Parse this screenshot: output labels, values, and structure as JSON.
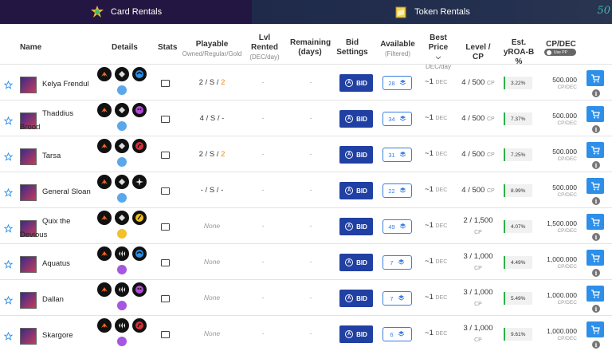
{
  "tabs": [
    {
      "label": "Card Rentals",
      "icon": "card-rentals-icon"
    },
    {
      "label": "Token Rentals",
      "icon": "token-rentals-icon"
    }
  ],
  "corner_badge": "50",
  "columns": {
    "name": "Name",
    "details": "Details",
    "stats": "Stats",
    "playable": "Playable",
    "playable_sub": "Owned/Regular/Gold",
    "lvl_rented": "Lvl Rented",
    "lvl_rented_sub": "(DEC/day)",
    "remaining": "Remaining (days)",
    "bid_settings": "Bid Settings",
    "available": "Available",
    "available_sub": "(Filtered)",
    "best_price": "Best Price",
    "best_price_sub": "DEC/day",
    "level_cp": "Level / CP",
    "yroa": "Est. yROA-B %",
    "cp_dec": "CP/DEC",
    "use_pp": "Use PP"
  },
  "colors": {
    "bid": "#2140a3",
    "cart": "#2d8fe8",
    "yroa_bar": "#2db04a",
    "gold": "#e58a1f"
  },
  "labels": {
    "bid": "BID",
    "dec": "DEC",
    "cp": "CP",
    "cp_dec": "CP/DEC",
    "dash": "-",
    "none": "None",
    "approx_prefix": "~"
  },
  "rows": [
    {
      "name": "Kelya Frendul",
      "wrap": false,
      "play_owned": "2",
      "play_regular": "S",
      "play_gold": "2",
      "play_none": false,
      "available": "28",
      "price": "1",
      "level": "4 / 500",
      "level_two_line": false,
      "yroa": "3.22%",
      "cp_dec": "500.000",
      "elements": [
        "fire",
        "neutral",
        "water",
        "water-gem"
      ]
    },
    {
      "name": "Thaddius Brood",
      "wrap": true,
      "play_owned": "4",
      "play_regular": "S",
      "play_gold": "-",
      "play_none": false,
      "available": "34",
      "price": "1",
      "level": "4 / 500",
      "level_two_line": false,
      "yroa": "7.37%",
      "cp_dec": "500.000",
      "elements": [
        "fire",
        "neutral",
        "death",
        "water-gem"
      ]
    },
    {
      "name": "Tarsa",
      "wrap": false,
      "play_owned": "2",
      "play_regular": "S",
      "play_gold": "2",
      "play_none": false,
      "available": "31",
      "price": "1",
      "level": "4 / 500",
      "level_two_line": false,
      "yroa": "7.25%",
      "cp_dec": "500.000",
      "elements": [
        "fire",
        "neutral",
        "fire-dragon",
        "water-gem"
      ]
    },
    {
      "name": "General Sloan",
      "wrap": false,
      "play_owned": "-",
      "play_regular": "S",
      "play_gold": "-",
      "play_none": false,
      "available": "22",
      "price": "1",
      "level": "4 / 500",
      "level_two_line": false,
      "yroa": "8.99%",
      "cp_dec": "500.000",
      "elements": [
        "fire",
        "neutral",
        "life",
        "water-gem"
      ]
    },
    {
      "name": "Quix the Devious",
      "wrap": true,
      "play_owned": "",
      "play_regular": "",
      "play_gold": "",
      "play_none": true,
      "available": "49",
      "price": "1",
      "level": "2 / 1,500",
      "level_two_line": true,
      "yroa": "4.07%",
      "cp_dec": "1,500.000",
      "elements": [
        "fire",
        "neutral",
        "earth",
        "gold-gem"
      ]
    },
    {
      "name": "Aquatus",
      "wrap": false,
      "play_owned": "",
      "play_regular": "",
      "play_gold": "",
      "play_none": true,
      "available": "7",
      "price": "1",
      "level": "3 / 1,000",
      "level_two_line": true,
      "yroa": "4.49%",
      "cp_dec": "1,000.000",
      "elements": [
        "fire",
        "wave",
        "water",
        "purple-gem"
      ]
    },
    {
      "name": "Dallan",
      "wrap": false,
      "play_owned": "",
      "play_regular": "",
      "play_gold": "",
      "play_none": true,
      "available": "7",
      "price": "1",
      "level": "3 / 1,000",
      "level_two_line": true,
      "yroa": "5.49%",
      "cp_dec": "1,000.000",
      "elements": [
        "fire",
        "wave",
        "death",
        "purple-gem"
      ]
    },
    {
      "name": "Skargore",
      "wrap": false,
      "play_owned": "",
      "play_regular": "",
      "play_gold": "",
      "play_none": true,
      "available": "6",
      "price": "1",
      "level": "3 / 1,000",
      "level_two_line": true,
      "yroa": "9.61%",
      "cp_dec": "1,000.000",
      "elements": [
        "fire",
        "wave",
        "fire-dragon",
        "purple-gem"
      ]
    }
  ]
}
